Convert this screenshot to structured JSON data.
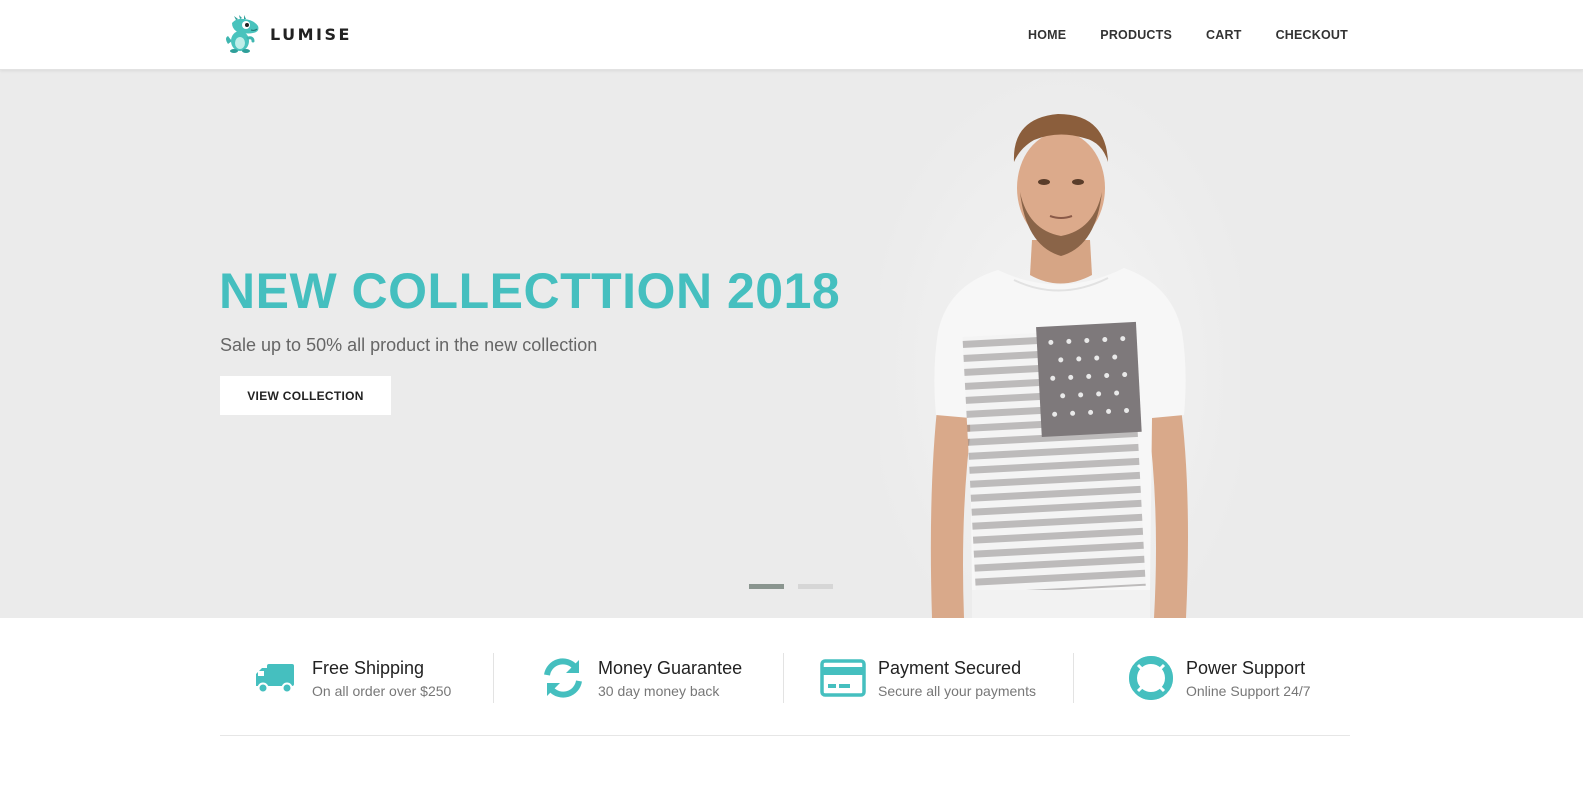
{
  "brand": {
    "name": "LUMISE",
    "accent_color": "#45bfbf",
    "mascot_icon": "dinosaur-mascot-icon"
  },
  "nav": {
    "items": [
      {
        "label": "HOME"
      },
      {
        "label": "PRODUCTS"
      },
      {
        "label": "CART"
      },
      {
        "label": "CHECKOUT"
      }
    ]
  },
  "hero": {
    "title": "NEW COLLECTTION 2018",
    "subtitle": "Sale up to 50% all product in the new collection",
    "button_label": "VIEW COLLECTION",
    "background_color": "#ebebeb",
    "slider": {
      "slide_count": 2,
      "active_index": 0
    }
  },
  "features": [
    {
      "icon": "truck-icon",
      "title": "Free Shipping",
      "desc": "On all order over $250"
    },
    {
      "icon": "refresh-icon",
      "title": "Money Guarantee",
      "desc": "30 day money back"
    },
    {
      "icon": "credit-card-icon",
      "title": "Payment Secured",
      "desc": "Secure all your payments"
    },
    {
      "icon": "lifebuoy-icon",
      "title": "Power Support",
      "desc": "Online Support 24/7"
    }
  ]
}
